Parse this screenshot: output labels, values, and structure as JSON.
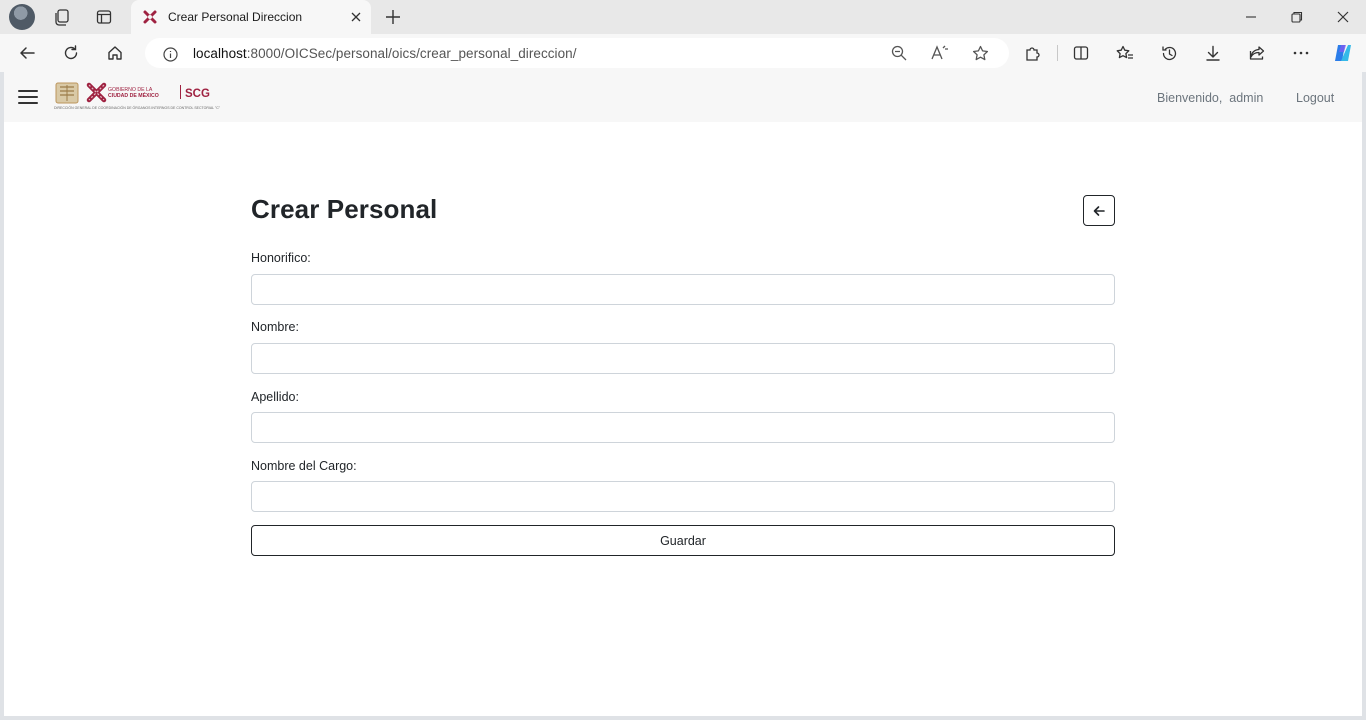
{
  "browser": {
    "tab_title": "Crear Personal Direccion",
    "url_host": "localhost",
    "url_rest": ":8000/OICSec/personal/oics/crear_personal_direccion/",
    "icons": [
      "profile-avatar",
      "workspaces-icon",
      "tab-actions-icon",
      "close-icon",
      "plus-icon",
      "back-arrow-icon",
      "refresh-icon",
      "home-icon",
      "info-icon",
      "zoom-icon",
      "read-aloud-icon",
      "favorite-star-icon",
      "extensions-icon",
      "split-screen-icon",
      "favorites-icon",
      "history-icon",
      "download-icon",
      "share-icon",
      "more-icon",
      "copilot-icon",
      "minimize-icon",
      "maximize-icon"
    ]
  },
  "navbar": {
    "logo_line1": "GOBIERNO DE LA",
    "logo_line2": "CIUDAD DE MÉXICO",
    "logo_acronym": "SCG",
    "logo_caption": "DIRECCIÓN GENERAL DE COORDINACIÓN DE ÓRGANOS INTERNOS DE CONTROL SECTORIAL \"C\"",
    "welcome_text": "Bienvenido,",
    "username": "admin",
    "logout_label": "Logout"
  },
  "form": {
    "title": "Crear Personal",
    "fields": [
      {
        "label": "Honorifico:",
        "value": ""
      },
      {
        "label": "Nombre:",
        "value": ""
      },
      {
        "label": "Apellido:",
        "value": ""
      },
      {
        "label": "Nombre del Cargo:",
        "value": ""
      }
    ],
    "submit_label": "Guardar"
  },
  "colors": {
    "brand_red": "#9f2241",
    "brand_gold": "#bc955c",
    "text_dark": "#212529",
    "text_muted": "#6c757d",
    "input_border": "#ced4da"
  }
}
